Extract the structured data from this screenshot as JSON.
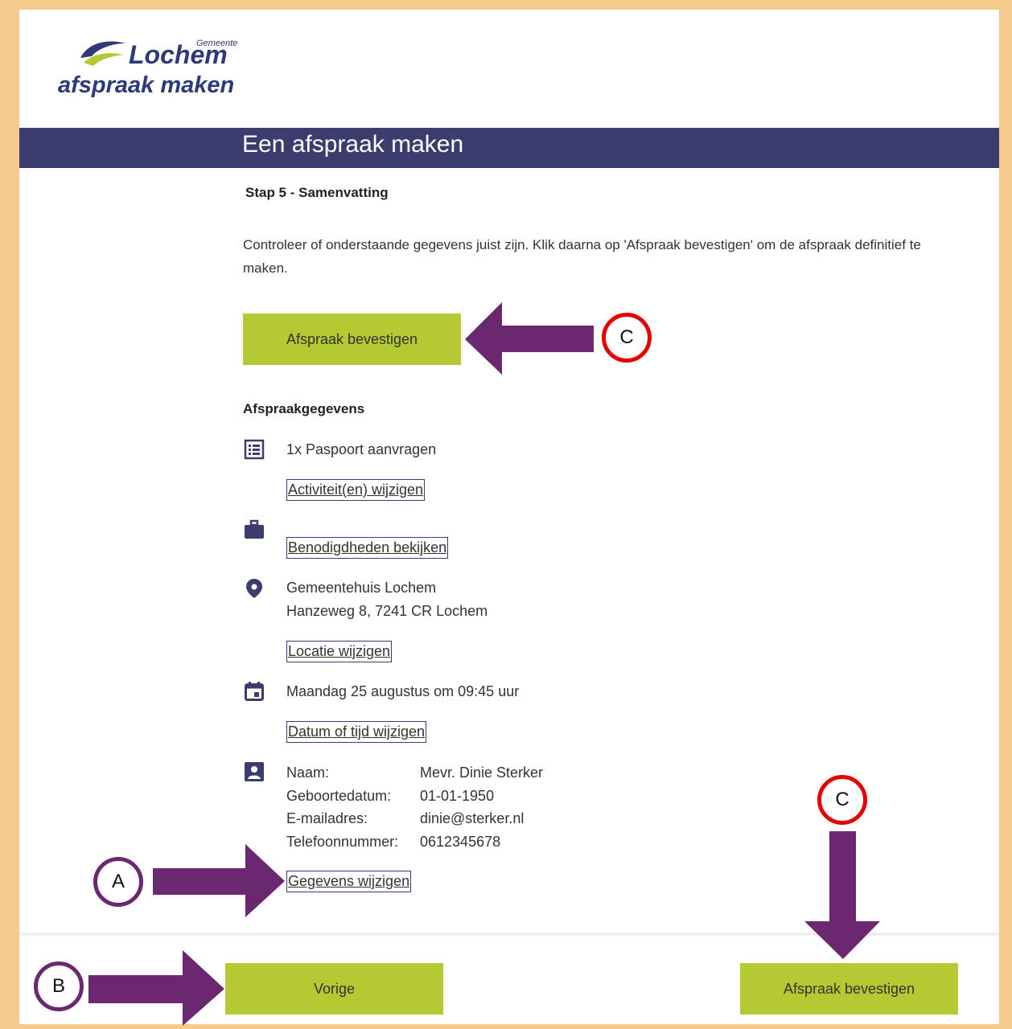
{
  "logo": {
    "gemeente": "Gemeente",
    "name": "Lochem",
    "subtitle": "afspraak maken"
  },
  "header": {
    "title": "Een afspraak maken"
  },
  "step": "Stap 5 - Samenvatting",
  "intro": "Controleer of onderstaande gegevens juist zijn. Klik daarna op 'Afspraak bevestigen' om de afspraak definitief te maken.",
  "confirm_label": "Afspraak bevestigen",
  "details": {
    "heading": "Afspraakgegevens",
    "activity": "1x Paspoort aanvragen",
    "activity_link": "Activiteit(en) wijzigen",
    "requirements_link": "Benodigdheden bekijken",
    "location_name": "Gemeentehuis Lochem",
    "location_address": "Hanzeweg 8, 7241 CR Lochem",
    "location_link": "Locatie wijzigen",
    "datetime": "Maandag 25 augustus om 09:45 uur",
    "datetime_link": "Datum of tijd wijzigen",
    "person": [
      {
        "label": "Naam:",
        "value": "Mevr. Dinie Sterker"
      },
      {
        "label": "Geboortedatum:",
        "value": "01-01-1950"
      },
      {
        "label": "E-mailadres:",
        "value": "dinie@sterker.nl"
      },
      {
        "label": "Telefoonnummer:",
        "value": "0612345678"
      }
    ],
    "person_link": "Gegevens wijzigen"
  },
  "footer": {
    "prev_label": "Vorige",
    "confirm_label": "Afspraak bevestigen"
  },
  "annotations": {
    "a": "A",
    "b": "B",
    "c": "C",
    "arrow_color": "#6b2770",
    "circle_red": "#e60000"
  },
  "colors": {
    "accent_green": "#b5c932",
    "banner": "#3b3d6f",
    "page_border": "#f6c98e"
  }
}
